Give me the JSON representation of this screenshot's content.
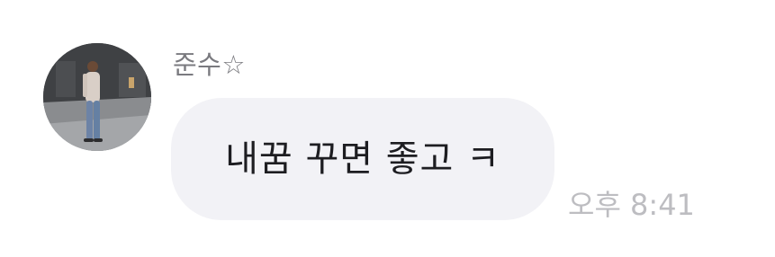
{
  "message": {
    "sender_name": "준수☆",
    "avatar_icon": "profile-photo",
    "text": "내꿈 꾸면 좋고 ㅋ",
    "timestamp": "오후 8:41"
  },
  "colors": {
    "background": "#ffffff",
    "bubble": "#f2f2f6",
    "message_text": "#1d1d21",
    "sender_name": "#7a7a7f",
    "timestamp": "#bdbdc1"
  }
}
